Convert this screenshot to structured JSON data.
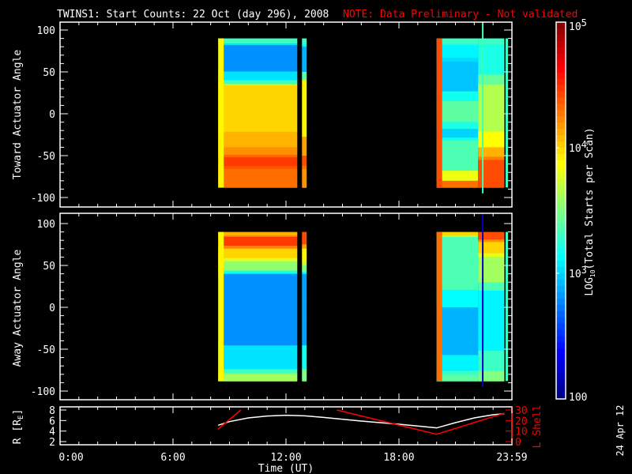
{
  "title": "TWINS1: Start Counts: 22 Oct (day 296), 2008",
  "note": "NOTE: Data Preliminary - Not validated",
  "colors": {
    "note": "#ff0000",
    "axis": "#ffffff",
    "l_shell": "#ff0000",
    "r_line": "#ffffff",
    "background": "#000000"
  },
  "footer_date": "24 Apr 12",
  "chart_data": [
    {
      "type": "heatmap",
      "name": "toward",
      "ylabel": "Toward Actuator Angle",
      "ylim": [
        -110,
        110
      ],
      "yticks": [
        "100",
        "50",
        "0",
        "-50",
        "-100"
      ],
      "ytick_values": [
        100,
        50,
        0,
        -50,
        -100
      ],
      "xlim_hours": [
        0,
        24
      ],
      "marker_hour": 22.45,
      "marker_color": "#40ffb0",
      "blocks": [
        {
          "t0": 8.4,
          "t1": 12.6,
          "bands": [
            [
              90,
              82,
              3.3
            ],
            [
              82,
              40,
              2.8
            ],
            [
              40,
              34,
              3.3
            ],
            [
              34,
              -40,
              4.0
            ],
            [
              -40,
              -52,
              4.2
            ],
            [
              -52,
              -66,
              4.45
            ],
            [
              -66,
              -88,
              4.3
            ]
          ],
          "edge": 3.9
        },
        {
          "t0": 12.85,
          "t1": 13.1,
          "bands": [
            [
              90,
              80,
              3.3
            ],
            [
              80,
              40,
              2.9
            ],
            [
              40,
              -50,
              3.9
            ],
            [
              -50,
              -66,
              4.4
            ],
            [
              -66,
              -88,
              4.2
            ]
          ],
          "edge": null
        },
        {
          "t0": 20.0,
          "t1": 22.2,
          "bands": [
            [
              90,
              82,
              3.3
            ],
            [
              82,
              62,
              3.1
            ],
            [
              62,
              15,
              2.95
            ],
            [
              15,
              -18,
              3.4
            ],
            [
              -18,
              -32,
              3.0
            ],
            [
              -32,
              -80,
              3.35
            ],
            [
              -80,
              -88,
              4.3
            ]
          ],
          "edge": 4.4
        },
        {
          "t0": 22.2,
          "t1": 23.6,
          "bands": [
            [
              90,
              82,
              3.3
            ],
            [
              82,
              35,
              3.2
            ],
            [
              35,
              -40,
              3.65
            ],
            [
              -40,
              -55,
              4.1
            ],
            [
              -55,
              -88,
              4.4
            ]
          ],
          "edge": null
        }
      ]
    },
    {
      "type": "heatmap",
      "name": "away",
      "ylabel": "Away Actuator Angle",
      "ylim": [
        -110,
        110
      ],
      "yticks": [
        "100",
        "50",
        "0",
        "-50",
        "-100"
      ],
      "ytick_values": [
        100,
        50,
        0,
        -50,
        -100
      ],
      "xlim_hours": [
        0,
        24
      ],
      "marker_hour": 22.45,
      "marker_color": "#0000c0",
      "blocks": [
        {
          "t0": 8.4,
          "t1": 12.6,
          "bands": [
            [
              90,
              84,
              4.1
            ],
            [
              84,
              70,
              4.45
            ],
            [
              70,
              55,
              4.0
            ],
            [
              55,
              40,
              3.55
            ],
            [
              40,
              -74,
              2.8
            ],
            [
              -74,
              -80,
              3.3
            ],
            [
              -80,
              -88,
              3.6
            ]
          ],
          "edge": 3.9
        },
        {
          "t0": 12.85,
          "t1": 13.1,
          "bands": [
            [
              90,
              70,
              4.4
            ],
            [
              70,
              50,
              3.9
            ],
            [
              50,
              40,
              3.5
            ],
            [
              40,
              -74,
              2.85
            ],
            [
              -74,
              -88,
              3.5
            ]
          ],
          "edge": null
        },
        {
          "t0": 20.0,
          "t1": 22.2,
          "bands": [
            [
              90,
              84,
              4.0
            ],
            [
              84,
              0,
              3.35
            ],
            [
              0,
              -76,
              2.9
            ],
            [
              -76,
              -82,
              3.3
            ],
            [
              -82,
              -88,
              3.4
            ]
          ],
          "edge": 4.3
        },
        {
          "t0": 22.2,
          "t1": 23.6,
          "bands": [
            [
              90,
              78,
              4.4
            ],
            [
              78,
              60,
              4.0
            ],
            [
              60,
              20,
              3.6
            ],
            [
              20,
              -76,
              3.1
            ],
            [
              -76,
              -88,
              3.5
            ]
          ],
          "edge": null
        }
      ]
    },
    {
      "type": "line",
      "name": "orbit",
      "ylabel": "R [R",
      "ylabel_sub": "E",
      "ylabel_end": "]",
      "ylim": [
        1.5,
        8.3
      ],
      "yticks": [
        "8",
        "6",
        "4",
        "2"
      ],
      "ytick_values": [
        8,
        6,
        4,
        2
      ],
      "y2label": "L Shell",
      "y2lim": [
        0,
        30
      ],
      "y2ticks": [
        "30",
        "20",
        "10",
        "0"
      ],
      "y2tick_values": [
        30,
        20,
        10,
        0
      ],
      "xlabel": "Time (UT)",
      "xticks": [
        "0:00",
        "6:00",
        "12:00",
        "18:00",
        "23:59"
      ],
      "xtick_values": [
        0,
        6,
        12,
        18,
        24
      ],
      "series": [
        {
          "name": "R",
          "axis": "left",
          "x": [
            8.4,
            9.0,
            10.0,
            11.0,
            12.0,
            13.0,
            14.0,
            16.0,
            18.0,
            20.0,
            21.0,
            22.0,
            23.0,
            23.6
          ],
          "y": [
            5.1,
            5.8,
            6.5,
            6.85,
            7.0,
            6.9,
            6.6,
            5.9,
            5.3,
            4.6,
            5.6,
            6.5,
            7.1,
            7.3
          ]
        },
        {
          "name": "L Shell",
          "axis": "right",
          "x": [
            8.4,
            9.6
          ],
          "y": [
            12,
            30
          ]
        },
        {
          "name": "L Shell",
          "axis": "right",
          "x": [
            14.7,
            20.0,
            23.6
          ],
          "y": [
            30,
            7,
            27
          ]
        }
      ]
    },
    {
      "type": "colorbar",
      "label_main": "LOG",
      "label_sub": "10",
      "label_rest": "(Total Starts per Scan)",
      "range_log10": [
        2,
        5
      ],
      "ticks": [
        {
          "base": "10",
          "exp": "5",
          "v": 5
        },
        {
          "base": "10",
          "exp": "4",
          "v": 4
        },
        {
          "base": "10",
          "exp": "3",
          "v": 3
        },
        {
          "base": "100",
          "exp": "",
          "v": 2
        }
      ]
    }
  ]
}
